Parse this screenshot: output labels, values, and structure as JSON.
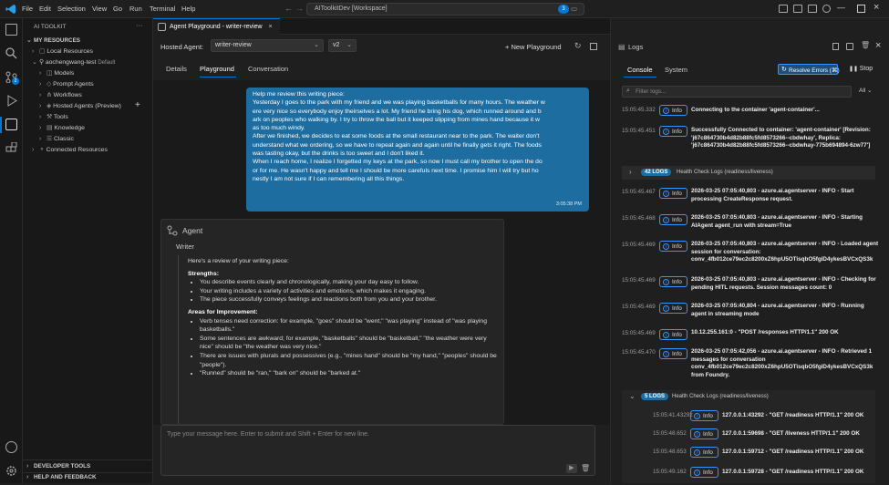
{
  "menu": [
    "File",
    "Edit",
    "Selection",
    "View",
    "Go",
    "Run",
    "Terminal",
    "Help"
  ],
  "search": {
    "text": "AIToolkitDev [Workspace]",
    "badge": "3"
  },
  "sidebar": {
    "title": "AI TOOLKIT",
    "section": "MY RESOURCES",
    "items": [
      {
        "label": "Local Resources",
        "indent": 1
      },
      {
        "label": "aochengwang-test",
        "suffix": "Default",
        "indent": 1
      },
      {
        "label": "Models",
        "indent": 2
      },
      {
        "label": "Prompt Agents",
        "indent": 2
      },
      {
        "label": "Workflows",
        "indent": 2
      },
      {
        "label": "Hosted Agents (Preview)",
        "indent": 2
      },
      {
        "label": "Tools",
        "indent": 2
      },
      {
        "label": "Knowledge",
        "indent": 2
      },
      {
        "label": "Classic",
        "indent": 2
      },
      {
        "label": "Connected Resources",
        "indent": 1
      }
    ],
    "bottom": [
      "DEVELOPER TOOLS",
      "HELP AND FEEDBACK"
    ]
  },
  "editor": {
    "tab": "Agent Playground - writer-review",
    "hosted_label": "Hosted Agent:",
    "agent_select": "writer-review",
    "version_select": "v2",
    "new_playground": "+ New Playground",
    "subtabs": [
      "Details",
      "Playground",
      "Conversation"
    ],
    "active_subtab": "Playground"
  },
  "user_message": {
    "lines": [
      "Help me review this writing piece:",
      "Yesterday I goes to the park with my friend and we was playing basketballs for many hours. The weather w",
      "ere very nice so everybody enjoy theirselves a lot. My friend he bring his dog, which runned around and b",
      "ark on peoples who walking by. I try to throw the ball but it keeped slipping from mines hand because it w",
      "as too much windy.",
      "After we finished, we decides to eat some foods at the small restaurant near to the park. The waiter don't",
      "understand what we ordering, so we have to repeat again and again until he finally gets it right. The foods",
      "was tasting okay, but the drinks is too sweet and I don't liked it.",
      "When I reach home, I realize I forgetted my keys at the park, so now I must call my brother to open the do",
      "or for me. He wasn't happy and tell me I should be more carefuls next time. I promise him I will try but ho",
      "nestly I am not sure if I can remembering all this things."
    ],
    "time": "3:05:38 PM"
  },
  "agent_reply": {
    "header": "Agent",
    "name": "Writer",
    "intro": "Here's a review of your writing piece:",
    "strengths_title": "Strengths:",
    "strengths": [
      "You describe events clearly and chronologically, making your day easy to follow.",
      "Your writing includes a variety of activities and emotions, which makes it engaging.",
      "The piece successfully conveys feelings and reactions both from you and your brother."
    ],
    "improve_title": "Areas for Improvement:",
    "improvements": [
      "Verb tenses need correction: for example, \"goes\" should be \"went,\" \"was playing\" instead of \"was playing basketballs.\"",
      "Some sentences are awkward; for example, \"basketballs\" should be \"basketball,\" \"the weather were very nice\" should be \"the weather was very nice.\"",
      "There are issues with plurals and possessives (e.g., \"mines hand\" should be \"my hand,\" \"peoples\" should be \"people\").",
      "\"Runned\" should be \"ran,\" \"bark on\" should be \"barked at.\""
    ]
  },
  "input": {
    "placeholder": "Type your message here. Enter to submit and Shift + Enter for new line."
  },
  "logs": {
    "title": "Logs",
    "tabs": [
      "Console",
      "System"
    ],
    "resolve": "Resolve Errors (⌘)",
    "stop": "Stop",
    "filter_placeholder": "Filter logs...",
    "filter_level": "All",
    "group1": {
      "count": "42 LOGS",
      "label": "Health Check Logs (readiness/liveness)"
    },
    "group2": {
      "count": "5 LOGS",
      "label": "Health Check Logs (readiness/liveness)"
    },
    "entries_a": [
      {
        "ts": "15:05:45.332",
        "level": "Info",
        "msg": "Connecting to the container 'agent-container'..."
      },
      {
        "ts": "15:05:45.451",
        "level": "Info",
        "msg": "Successfully Connected to container: 'agent-container' [Revision: 'j67c864730b4d82b88fc5fd8573266--cbdwhay', Replica: 'j67c864730b4d82b88fc5fd8573266--cbdwhay-775b694894-6zw77']"
      }
    ],
    "entries_b": [
      {
        "ts": "15:05:45.467",
        "level": "Info",
        "msg": "2026-03-25 07:05:40,803 - azure.ai.agentserver - INFO - Start processing CreateResponse request."
      },
      {
        "ts": "15:05:45.468",
        "level": "Info",
        "msg": "2026-03-25 07:05:40,803 - azure.ai.agentserver - INFO - Starting AIAgent agent_run with stream=True"
      },
      {
        "ts": "15:05:45.469",
        "level": "Info",
        "msg": "2026-03-25 07:05:40,803 - azure.ai.agentserver - INFO - Loaded agent session for conversation: conv_4fb012ce79ec2c8200xZ6hpU5OTisqbO5fgiD4ykesBVCxQS3k"
      },
      {
        "ts": "15:05:45.469",
        "level": "Info",
        "msg": "2026-03-25 07:05:40,803 - azure.ai.agentserver - INFO - Checking for pending HITL requests. Session messages count: 0"
      },
      {
        "ts": "15:05:45.469",
        "level": "Info",
        "msg": "2026-03-25 07:05:40,804 - azure.ai.agentserver - INFO - Running agent in streaming mode"
      },
      {
        "ts": "15:05:45.469",
        "level": "Info",
        "msg": "10.12.255.161:0 - \"POST /responses HTTP/1.1\" 200 OK"
      },
      {
        "ts": "15:05:45.470",
        "level": "Info",
        "msg": "2026-03-25 07:05:42,056 - azure.ai.agentserver - INFO - Retrieved 1 messages for conversation conv_4fb012ce79ec2c8200xZ6hpU5OTisqbO5fgiD4ykesBVCxQS3k from Foundry."
      }
    ],
    "entries_c": [
      {
        "ts": "15:05:41.43292",
        "level": "Info",
        "msg": "127.0.0.1:43292 - \"GET /readiness HTTP/1.1\" 200 OK"
      },
      {
        "ts": "15:05:48.652",
        "level": "Info",
        "msg": "127.0.0.1:59698 - \"GET /liveness HTTP/1.1\" 200 OK"
      },
      {
        "ts": "15:05:48.653",
        "level": "Info",
        "msg": "127.0.0.1:59712 - \"GET /readiness HTTP/1.1\" 200 OK"
      },
      {
        "ts": "15:05:49.162",
        "level": "Info",
        "msg": "127.0.0.1:59728 - \"GET /readiness HTTP/1.1\" 200 OK"
      }
    ]
  },
  "colors": {
    "accent": "#0078d4",
    "bubble": "#1e6da0",
    "info_border": "#3794ff"
  }
}
